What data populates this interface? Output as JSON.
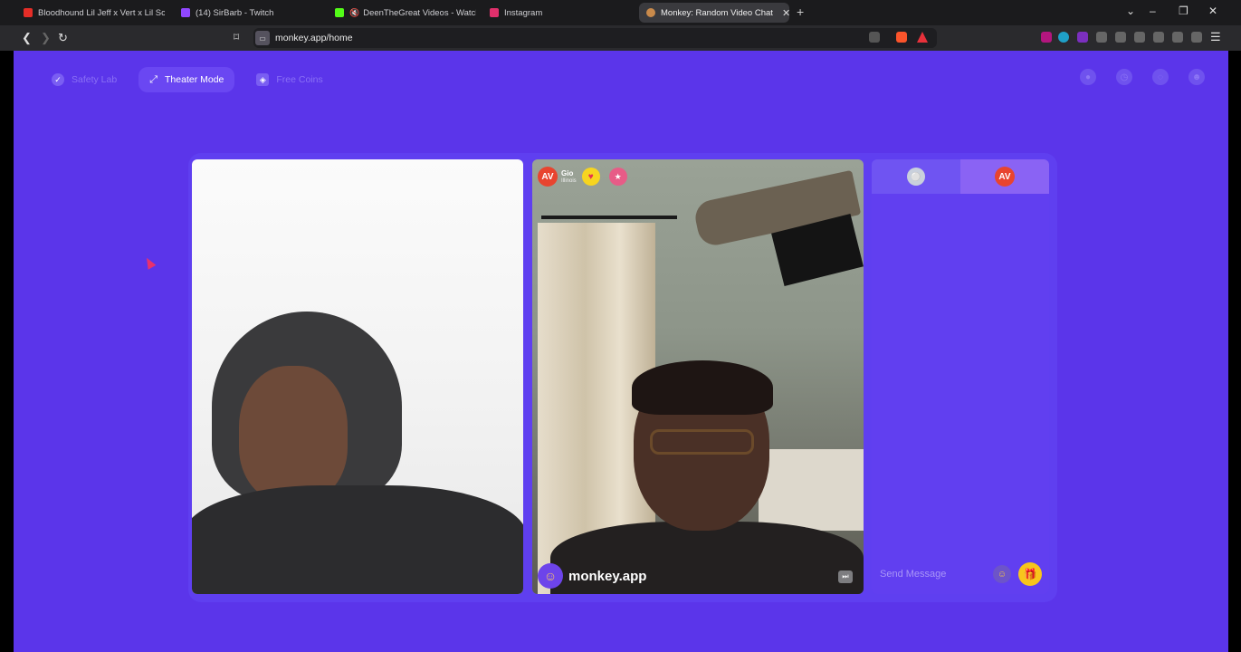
{
  "browser": {
    "tabs": [
      {
        "title": "Bloodhound Lil Jeff x Vert x Lil Scoom",
        "favicon_color": "#e52d27",
        "active": false
      },
      {
        "title": "(14) SirBarb - Twitch",
        "favicon_color": "#9147ff",
        "active": false
      },
      {
        "title": "DeenTheGreat Videos - Watch O",
        "favicon_color": "#53fc18",
        "active": false
      },
      {
        "title": "Instagram",
        "favicon_color": "#e1306c",
        "active": false
      },
      {
        "title": "Monkey: Random Video Chat",
        "favicon_color": "#c98a4b",
        "active": true
      }
    ],
    "new_tab_icon": "+",
    "url": "monkey.app/home",
    "window_controls": {
      "minimize": "–",
      "maximize": "❐",
      "close": "✕"
    }
  },
  "page": {
    "nav": [
      {
        "label": "Safety Lab",
        "icon": "shield-icon",
        "active": false
      },
      {
        "label": "Theater Mode",
        "icon": "expand-icon",
        "active": true
      },
      {
        "label": "Free Coins",
        "icon": "coin-icon",
        "active": false
      }
    ],
    "right_icons": [
      "profile-icon",
      "history-icon",
      "messages-icon",
      "avatar-icon"
    ],
    "partner": {
      "initials": "AV",
      "name": "Gio",
      "location": "Illinois",
      "watermark": "monkey.app"
    },
    "chat": {
      "partner_initials": "AV",
      "placeholder": "Send Message"
    }
  },
  "colors": {
    "page_bg": "#5b35ea",
    "accent": "#6a47f2",
    "gift": "#f8c51c"
  }
}
